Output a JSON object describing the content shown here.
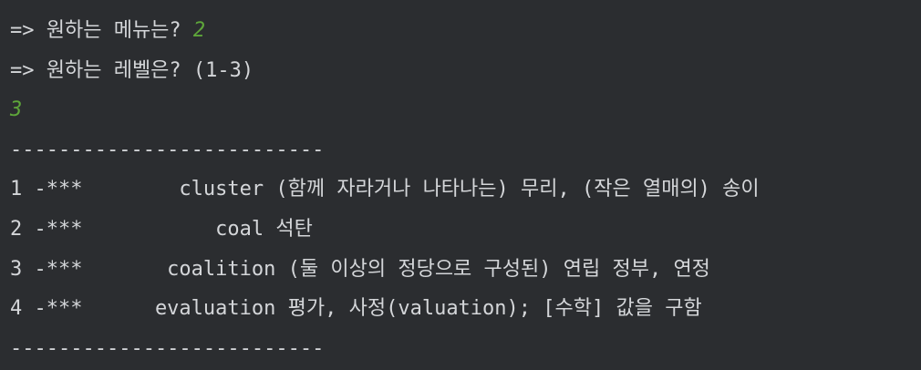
{
  "console": {
    "prompt_menu": "=> 원하는 메뉴는? ",
    "input_menu": "2",
    "prompt_level": "=> 원하는 레벨은? (1-3)",
    "input_level": "3",
    "separator": "--------------------------",
    "rows": [
      {
        "text": "1 -***        cluster (함께 자라거나 나타나는) 무리, (작은 열매의) 송이"
      },
      {
        "text": "2 -***           coal 석탄"
      },
      {
        "text": "3 -***       coalition (둘 이상의 정당으로 구성된) 연립 정부, 연정"
      },
      {
        "text": "4 -***      evaluation 평가, 사정(valuation); [수학] 값을 구함"
      }
    ],
    "separator_bottom": "--------------------------"
  },
  "colors": {
    "background": "#2b2d30",
    "text": "#d4d6d9",
    "user_input": "#5ea63a"
  }
}
